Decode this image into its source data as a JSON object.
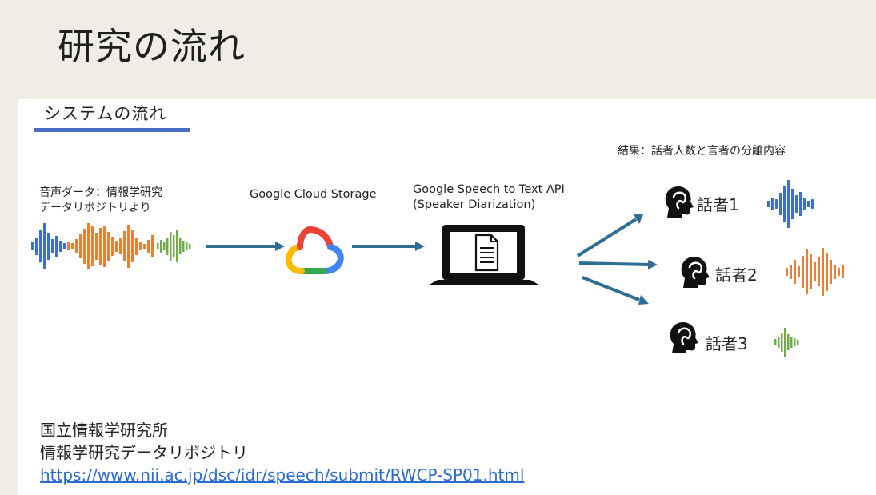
{
  "slide": {
    "title": "研究の流れ"
  },
  "section": {
    "title": "システムの流れ"
  },
  "source": {
    "line1": "音声ダータ：情報学研究",
    "line2": "データリポジトリより"
  },
  "storage": {
    "label": "Google Cloud Storage"
  },
  "api": {
    "line1": "Google Speech to Text API",
    "line2": "(Speaker Diarization)"
  },
  "result": {
    "label": "結果：話者人数と言者の分離内容"
  },
  "speakers": [
    {
      "label": "話者1",
      "color": "#3b6fd0"
    },
    {
      "label": "話者2",
      "color": "#ed7d31"
    },
    {
      "label": "話者3",
      "color": "#70ad47"
    }
  ],
  "colors": {
    "arrow": "#2f6e93",
    "underline": "#4a6cc4",
    "link": "#2a6ad6"
  },
  "icons": [
    "audio-waveform-icon",
    "google-cloud-icon",
    "laptop-document-icon",
    "speaker-head-icon"
  ],
  "credits": {
    "line1": "国立情報学研究所",
    "line2": "情報学研究データリポジトリ",
    "url": "https://www.nii.ac.jp/dsc/idr/speech/submit/RWCP-SP01.html"
  }
}
